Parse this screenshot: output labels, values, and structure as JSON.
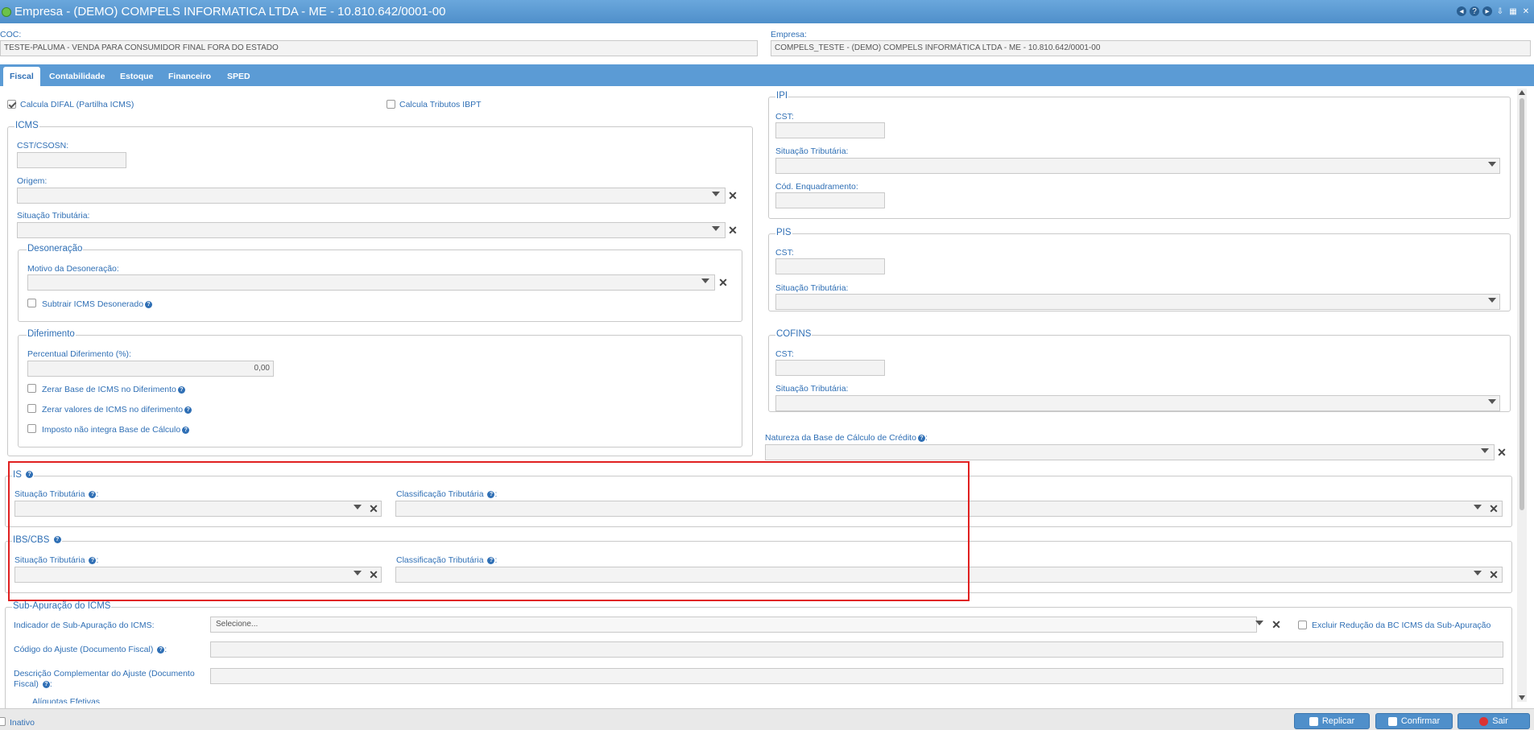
{
  "window": {
    "title": "Empresa - (DEMO) COMPELS INFORMATICA LTDA - ME - 10.810.642/0001-00"
  },
  "header": {
    "coc_label": "COC:",
    "coc_value": "TESTE-PALUMA - VENDA PARA CONSUMIDOR FINAL FORA DO ESTADO",
    "empresa_label": "Empresa:",
    "empresa_value": "COMPELS_TESTE - (DEMO) COMPELS INFORMÁTICA LTDA - ME - 10.810.642/0001-00"
  },
  "tabs": [
    "Fiscal",
    "Contabilidade",
    "Estoque",
    "Financeiro",
    "SPED"
  ],
  "top_checks": {
    "difal": "Calcula DIFAL (Partilha ICMS)",
    "ibpt": "Calcula Tributos IBPT"
  },
  "icms": {
    "legend": "ICMS",
    "cst_label": "CST/CSOSN:",
    "origem_label": "Origem:",
    "situacao_label": "Situação Tributária:",
    "desoneracao": {
      "legend": "Desoneração",
      "motivo_label": "Motivo da Desoneração:",
      "subtrair_label": "Subtrair ICMS Desonerado"
    },
    "diferimento": {
      "legend": "Diferimento",
      "percentual_label": "Percentual Diferimento (%):",
      "percentual_value": "0,00",
      "zerar_base": "Zerar Base de ICMS no Diferimento",
      "zerar_valores": "Zerar valores de ICMS no diferimento",
      "imposto_nao": "Imposto não integra Base de Cálculo"
    }
  },
  "ipi": {
    "legend": "IPI",
    "cst_label": "CST:",
    "situacao_label": "Situação Tributária:",
    "enquadramento_label": "Cód. Enquadramento:"
  },
  "pis": {
    "legend": "PIS",
    "cst_label": "CST:",
    "situacao_label": "Situação Tributária:"
  },
  "cofins": {
    "legend": "COFINS",
    "cst_label": "CST:",
    "situacao_label": "Situação Tributária:"
  },
  "natureza_label": "Natureza da Base de Cálculo de Crédito",
  "is": {
    "legend": "IS",
    "situacao_label": "Situação Tributária",
    "classificacao_label": "Classificação Tributária"
  },
  "ibscbs": {
    "legend": "IBS/CBS",
    "situacao_label": "Situação Tributária",
    "classificacao_label": "Classificação Tributária"
  },
  "subapuracao": {
    "legend": "Sub-Apuração do ICMS",
    "indicador_label": "Indicador de Sub-Apuração do ICMS:",
    "indicador_value": "Selecione...",
    "excluir_label": "Excluir Redução da BC ICMS da Sub-Apuração",
    "codigo_label": "Código do Ajuste (Documento Fiscal)",
    "descricao_label_1": "Descrição Complementar do Ajuste (Documento",
    "descricao_label_2": "Fiscal)",
    "aliquotas_legend": "Alíquotas Efetivas"
  },
  "footer": {
    "inativo": "Inativo",
    "replicar": "Replicar",
    "confirmar": "Confirmar",
    "sair": "Sair"
  }
}
